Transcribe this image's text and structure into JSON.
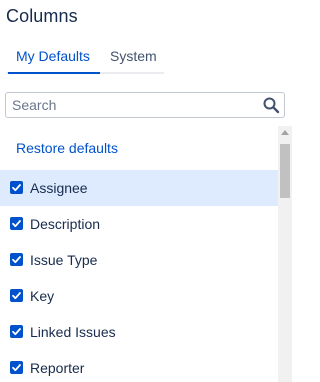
{
  "panel": {
    "title": "Columns"
  },
  "tabs": [
    {
      "label": "My Defaults",
      "active": true
    },
    {
      "label": "System",
      "active": false
    }
  ],
  "search": {
    "placeholder": "Search",
    "value": ""
  },
  "restore_label": "Restore defaults",
  "columns": [
    {
      "label": "Assignee",
      "checked": true,
      "selected": true
    },
    {
      "label": "Description",
      "checked": true,
      "selected": false
    },
    {
      "label": "Issue Type",
      "checked": true,
      "selected": false
    },
    {
      "label": "Key",
      "checked": true,
      "selected": false
    },
    {
      "label": "Linked Issues",
      "checked": true,
      "selected": false
    },
    {
      "label": "Reporter",
      "checked": true,
      "selected": false
    }
  ],
  "colors": {
    "accent": "#0052cc",
    "selected_row": "#deebff",
    "text": "#172b4d"
  },
  "icons": {
    "search": "search-icon",
    "checkbox": "checkmark-icon"
  }
}
